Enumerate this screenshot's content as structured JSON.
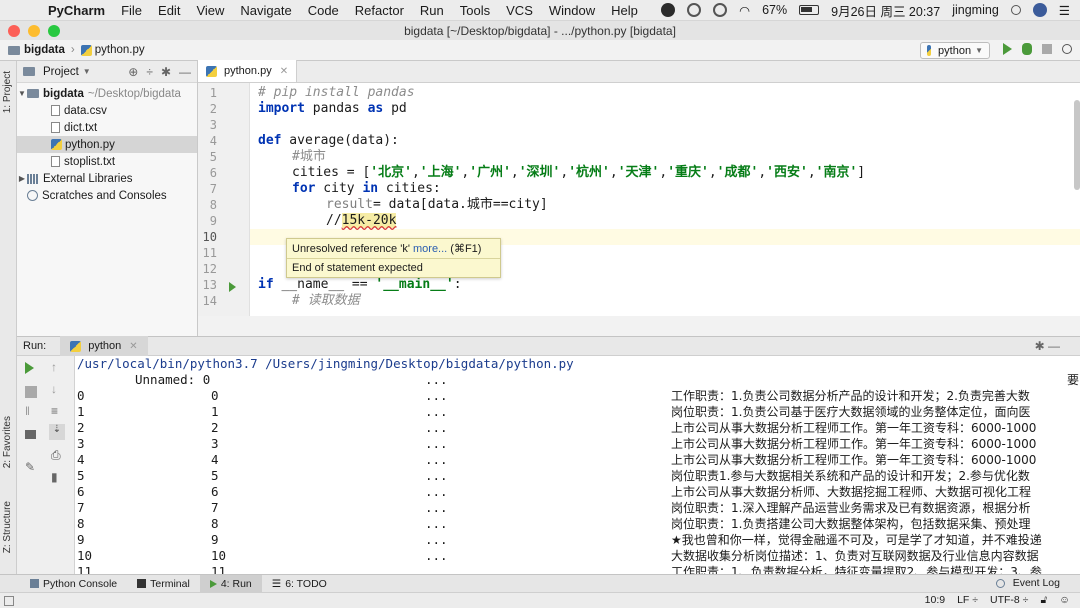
{
  "menubar": {
    "app": "PyCharm",
    "items": [
      "File",
      "Edit",
      "View",
      "Navigate",
      "Code",
      "Refactor",
      "Run",
      "Tools",
      "VCS",
      "Window",
      "Help"
    ],
    "battery": "67%",
    "datetime": "9月26日 周三  20:37",
    "user": "jingming"
  },
  "window": {
    "title": "bigdata [~/Desktop/bigdata] - .../python.py [bigdata]"
  },
  "navbar": {
    "project": "bigdata",
    "file": "python.py",
    "run_config": "python"
  },
  "project_panel": {
    "title": "Project",
    "root": "bigdata",
    "root_path": "~/Desktop/bigdata",
    "files": [
      "data.csv",
      "dict.txt",
      "python.py",
      "stoplist.txt"
    ],
    "external": "External Libraries",
    "scratches": "Scratches and Consoles"
  },
  "left_stripe": {
    "project_tab": "1: Project",
    "favorites_tab": "2: Favorites",
    "structure_tab": "Z: Structure"
  },
  "editor": {
    "tab": "python.py",
    "line_numbers": [
      "1",
      "2",
      "3",
      "4",
      "5",
      "6",
      "7",
      "8",
      "9",
      "10",
      "11",
      "12",
      "13",
      "14"
    ],
    "code": {
      "l1": "# pip install pandas",
      "l2_kw": "import",
      "l2_a": " pandas ",
      "l2_kw2": "as",
      "l2_b": " pd",
      "l4_kw": "def",
      "l4_rest": " average(data):",
      "l5": "#城市",
      "l6_a": "cities = [",
      "l6_items": [
        "'北京'",
        "'上海'",
        "'广州'",
        "'深圳'",
        "'杭州'",
        "'天津'",
        "'重庆'",
        "'成都'",
        "'西安'",
        "'南京'"
      ],
      "l6_close": "]",
      "l7_kw": "for",
      "l7_a": " city ",
      "l7_kw2": "in",
      "l7_b": " cities:",
      "l8_a": "result",
      "l8_b": "= data[data.城市==city]",
      "l9_a": "//",
      "l9_b": "15k-20k",
      "l13_kw": "if",
      "l13_a": " __name__ == ",
      "l13_str": "'__main__'",
      "l13_b": ":",
      "l14": "# 读取数据"
    },
    "tooltip": {
      "line1": "Unresolved reference 'k'",
      "more": "more...",
      "shortcut": "(⌘F1)",
      "line2": "End of statement expected"
    }
  },
  "run_panel": {
    "label": "Run:",
    "tab": "python",
    "command": "/usr/local/bin/python3.7 /Users/jingming/Desktop/bigdata/python.py",
    "header": {
      "unnamed": "Unnamed: 0",
      "dots": "...",
      "right": "要"
    },
    "rows": [
      {
        "idx": "0",
        "val": "0",
        "text": "工作职责：1.负责公司数据分析产品的设计和开发；2.负责完善大数"
      },
      {
        "idx": "1",
        "val": "1",
        "text": "岗位职责：1.负责公司基于医疗大数据领域的业务整体定位，面向医"
      },
      {
        "idx": "2",
        "val": "2",
        "text": "上市公司从事大数据分析工程师工作。第一年工资专科：6000-1000"
      },
      {
        "idx": "3",
        "val": "3",
        "text": "上市公司从事大数据分析工程师工作。第一年工资专科：6000-1000"
      },
      {
        "idx": "4",
        "val": "4",
        "text": "上市公司从事大数据分析工程师工作。第一年工资专科：6000-1000"
      },
      {
        "idx": "5",
        "val": "5",
        "text": "岗位职责1.参与大数据相关系统和产品的设计和开发；2.参与优化数"
      },
      {
        "idx": "6",
        "val": "6",
        "text": "上市公司从事大数据分析师、大数据挖掘工程师、大数据可视化工程"
      },
      {
        "idx": "7",
        "val": "7",
        "text": "岗位职责：1.深入理解产品运营业务需求及已有数据资源，根据分析"
      },
      {
        "idx": "8",
        "val": "8",
        "text": "岗位职责：1.负责搭建公司大数据整体架构，包括数据采集、预处理"
      },
      {
        "idx": "9",
        "val": "9",
        "text": "★我也曾和你一样，觉得金融遥不可及，可是学了才知道，并不难投递"
      },
      {
        "idx": "10",
        "val": "10",
        "text": "大数据收集分析岗位描述：1、负责对互联网数据及行业信息内容数据"
      },
      {
        "idx": "11",
        "val": "11",
        "text": "工作职责：1、负责数据分析，特征变量提取2、参与模型开发；3、参"
      }
    ]
  },
  "bottom_tabs": [
    "Python Console",
    "Terminal",
    "4: Run",
    "6: TODO"
  ],
  "event_log": "Event Log",
  "status": {
    "position": "10:9",
    "line_sep": "LF ÷",
    "encoding": "UTF-8 ÷"
  },
  "colors": {
    "keyword": "#0033b3",
    "string": "#067d17",
    "comment": "#8c8c8c",
    "run_green": "#4b9a3a"
  }
}
